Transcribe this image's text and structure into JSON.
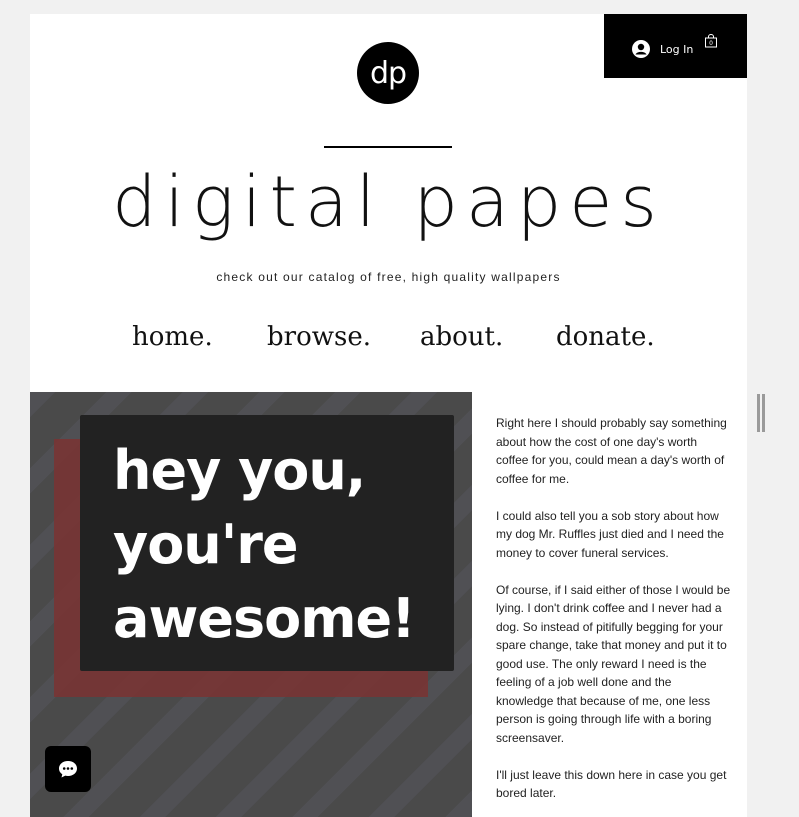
{
  "header": {
    "login_label": "Log In",
    "cart_count": "0"
  },
  "logo": {
    "text": "dp"
  },
  "site": {
    "title": "digital papes",
    "tagline": "check out our catalog of free, high quality wallpapers"
  },
  "nav": {
    "items": [
      {
        "label": "home."
      },
      {
        "label": "browse."
      },
      {
        "label": "about."
      },
      {
        "label": "donate."
      }
    ]
  },
  "hero": {
    "line1": "hey you,",
    "line2": "you're",
    "line3": "awesome!"
  },
  "body": {
    "p1": "Right here I should probably say something about how the cost of one day's worth coffee for you, could mean a day's worth of coffee for me.",
    "p2": "I could also tell you a sob story about how my dog Mr. Ruffles just died and I need the money to cover funeral services.",
    "p3": "Of course, if I said either of those I would be lying. I don't drink coffee and I never had a dog. So instead of pitifully begging for your spare change, take that money and put it to good use. The only reward I need is the feeling of a job well done and the knowledge that because of me, one less person is going through life with a boring screensaver.",
    "p4": "I'll just leave this down here in case you get bored later."
  },
  "icons": {
    "avatar": "user-avatar-icon",
    "cart": "shopping-bag-icon",
    "chat": "chat-icon"
  }
}
